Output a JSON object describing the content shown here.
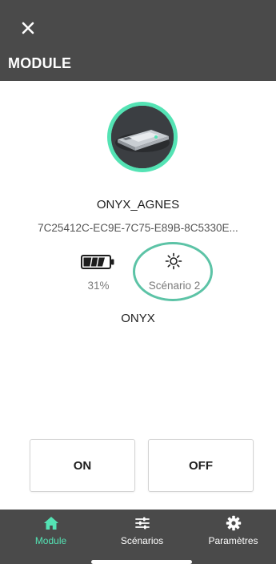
{
  "header": {
    "title": "MODULE",
    "close_icon": "close-icon"
  },
  "device": {
    "avatar_icon": "module-device-image",
    "name": "ONYX_AGNES",
    "id": "7C25412C-EC9E-7C75-E89B-8C5330E...",
    "battery_icon": "battery-icon",
    "battery_percent": 31,
    "battery_value": "31%",
    "scenario_icon": "sun-icon",
    "scenario_label": "Scénario 2",
    "type": "ONYX"
  },
  "controls": {
    "on_label": "ON",
    "off_label": "OFF"
  },
  "bottom_nav": {
    "items": [
      {
        "label": "Module",
        "icon": "home-icon",
        "active": true
      },
      {
        "label": "Scénarios",
        "icon": "sliders-icon",
        "active": false
      },
      {
        "label": "Paramètres",
        "icon": "gear-icon",
        "active": false
      }
    ]
  },
  "colors": {
    "header_bg": "#4a4a4a",
    "accent": "#54e3b4",
    "highlight_ring": "#5cc3a6"
  }
}
